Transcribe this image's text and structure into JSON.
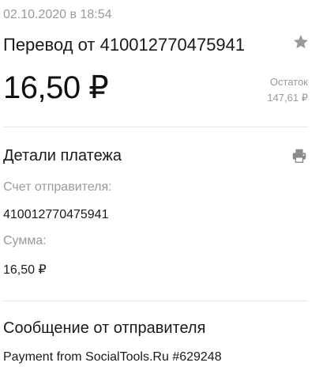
{
  "header": {
    "date": "02.10.2020 в 18:54",
    "title": "Перевод от 410012770475941",
    "amount": "16,50 ₽",
    "balance_label": "Остаток",
    "balance_value": "147,61 ₽"
  },
  "details": {
    "heading": "Детали платежа",
    "sender_account_label": "Счет отправителя:",
    "sender_account_value": "410012770475941",
    "sum_label": "Сумма:",
    "sum_value": "16,50 ₽"
  },
  "message": {
    "heading": "Сообщение от отправителя",
    "text": "Payment from SocialTools.Ru #629248"
  },
  "icons": {
    "favorite": "star-icon",
    "print": "printer-icon"
  },
  "colors": {
    "muted": "#9a9a9a",
    "text": "#1a1a1a",
    "divider": "#e6e6e6"
  }
}
